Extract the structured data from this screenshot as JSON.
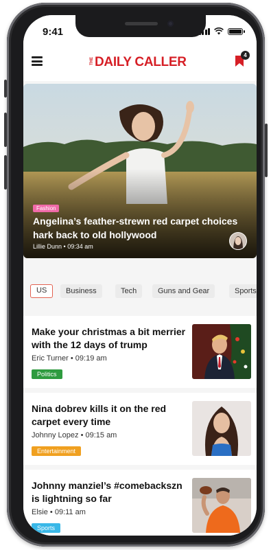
{
  "status_bar": {
    "time": "9:41"
  },
  "header": {
    "logo_prefix": "THE",
    "logo_text": "DAILY CALLER",
    "bookmark_count": "4"
  },
  "hero": {
    "category": "Fashion",
    "title": "Angelina’s feather-strewn red carpet choices hark back to old hollywood",
    "author": "Lillie Dunn",
    "time": "09:34 am"
  },
  "tabs": [
    {
      "label": "US"
    },
    {
      "label": "Business"
    },
    {
      "label": "Tech"
    },
    {
      "label": "Guns and Gear"
    },
    {
      "label": "Sports"
    }
  ],
  "articles": [
    {
      "title": "Make your christmas a bit merrier with the 12 days of trump",
      "author": "Eric Turner",
      "time": "09:19 am",
      "category": "Politics",
      "category_color": "#2e9b3f"
    },
    {
      "title": "Nina dobrev kills it on the red carpet every time",
      "author": "Johnny Lopez",
      "time": "09:15 am",
      "category": "Entertainment",
      "category_color": "#f0a020"
    },
    {
      "title": "Johnny manziel’s #comebackszn is lightning so far",
      "author": "Elsie",
      "time": "09:11 am",
      "category": "Sports",
      "category_color": "#3ab8e8"
    }
  ],
  "colors": {
    "brand_red": "#d61f26",
    "active_tab_border": "#e2604f",
    "fashion_pink": "#f06aa8"
  }
}
